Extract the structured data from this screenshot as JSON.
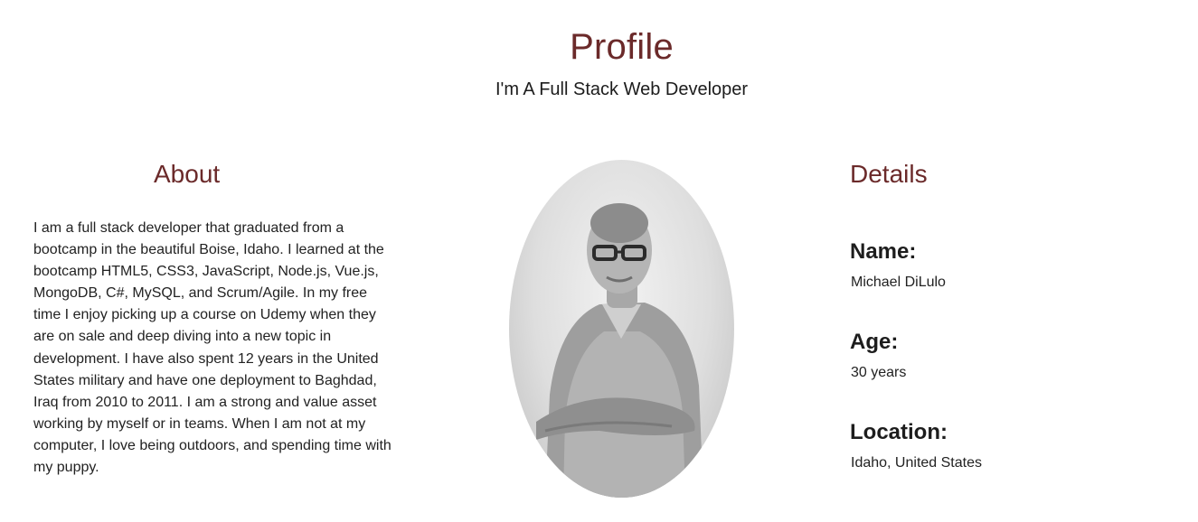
{
  "header": {
    "title": "Profile",
    "subtitle": "I'm A Full Stack Web Developer"
  },
  "about": {
    "heading": "About",
    "text": "I am a full stack developer that graduated from a bootcamp in the beautiful Boise, Idaho. I learned at the bootcamp HTML5, CSS3, JavaScript, Node.js, Vue.js, MongoDB, C#, MySQL, and Scrum/Agile. In my free time I enjoy picking up a course on Udemy when they are on sale and deep diving into a new topic in development. I have also spent 12 years in the United States military and have one deployment to Baghdad, Iraq from 2010 to 2011. I am a strong and value asset working by myself or in teams. When I am not at my computer, I love being outdoors, and spending time with my puppy."
  },
  "details": {
    "heading": "Details",
    "items": [
      {
        "label": "Name:",
        "value": "Michael DiLulo"
      },
      {
        "label": "Age:",
        "value": "30 years"
      },
      {
        "label": "Location:",
        "value": "Idaho, United States"
      }
    ]
  },
  "colors": {
    "accent": "#6b2a2a",
    "text": "#1f1f1f",
    "background": "#ffffff"
  }
}
